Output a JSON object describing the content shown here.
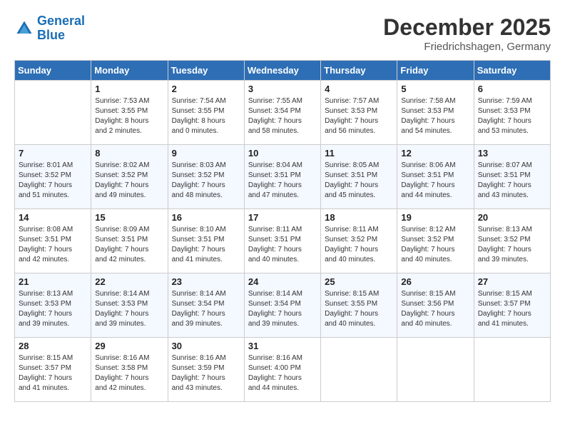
{
  "header": {
    "logo_line1": "General",
    "logo_line2": "Blue",
    "month": "December 2025",
    "location": "Friedrichshagen, Germany"
  },
  "weekdays": [
    "Sunday",
    "Monday",
    "Tuesday",
    "Wednesday",
    "Thursday",
    "Friday",
    "Saturday"
  ],
  "weeks": [
    [
      {
        "day": "",
        "info": ""
      },
      {
        "day": "1",
        "info": "Sunrise: 7:53 AM\nSunset: 3:55 PM\nDaylight: 8 hours\nand 2 minutes."
      },
      {
        "day": "2",
        "info": "Sunrise: 7:54 AM\nSunset: 3:55 PM\nDaylight: 8 hours\nand 0 minutes."
      },
      {
        "day": "3",
        "info": "Sunrise: 7:55 AM\nSunset: 3:54 PM\nDaylight: 7 hours\nand 58 minutes."
      },
      {
        "day": "4",
        "info": "Sunrise: 7:57 AM\nSunset: 3:53 PM\nDaylight: 7 hours\nand 56 minutes."
      },
      {
        "day": "5",
        "info": "Sunrise: 7:58 AM\nSunset: 3:53 PM\nDaylight: 7 hours\nand 54 minutes."
      },
      {
        "day": "6",
        "info": "Sunrise: 7:59 AM\nSunset: 3:53 PM\nDaylight: 7 hours\nand 53 minutes."
      }
    ],
    [
      {
        "day": "7",
        "info": "Sunrise: 8:01 AM\nSunset: 3:52 PM\nDaylight: 7 hours\nand 51 minutes."
      },
      {
        "day": "8",
        "info": "Sunrise: 8:02 AM\nSunset: 3:52 PM\nDaylight: 7 hours\nand 49 minutes."
      },
      {
        "day": "9",
        "info": "Sunrise: 8:03 AM\nSunset: 3:52 PM\nDaylight: 7 hours\nand 48 minutes."
      },
      {
        "day": "10",
        "info": "Sunrise: 8:04 AM\nSunset: 3:51 PM\nDaylight: 7 hours\nand 47 minutes."
      },
      {
        "day": "11",
        "info": "Sunrise: 8:05 AM\nSunset: 3:51 PM\nDaylight: 7 hours\nand 45 minutes."
      },
      {
        "day": "12",
        "info": "Sunrise: 8:06 AM\nSunset: 3:51 PM\nDaylight: 7 hours\nand 44 minutes."
      },
      {
        "day": "13",
        "info": "Sunrise: 8:07 AM\nSunset: 3:51 PM\nDaylight: 7 hours\nand 43 minutes."
      }
    ],
    [
      {
        "day": "14",
        "info": "Sunrise: 8:08 AM\nSunset: 3:51 PM\nDaylight: 7 hours\nand 42 minutes."
      },
      {
        "day": "15",
        "info": "Sunrise: 8:09 AM\nSunset: 3:51 PM\nDaylight: 7 hours\nand 42 minutes."
      },
      {
        "day": "16",
        "info": "Sunrise: 8:10 AM\nSunset: 3:51 PM\nDaylight: 7 hours\nand 41 minutes."
      },
      {
        "day": "17",
        "info": "Sunrise: 8:11 AM\nSunset: 3:51 PM\nDaylight: 7 hours\nand 40 minutes."
      },
      {
        "day": "18",
        "info": "Sunrise: 8:11 AM\nSunset: 3:52 PM\nDaylight: 7 hours\nand 40 minutes."
      },
      {
        "day": "19",
        "info": "Sunrise: 8:12 AM\nSunset: 3:52 PM\nDaylight: 7 hours\nand 40 minutes."
      },
      {
        "day": "20",
        "info": "Sunrise: 8:13 AM\nSunset: 3:52 PM\nDaylight: 7 hours\nand 39 minutes."
      }
    ],
    [
      {
        "day": "21",
        "info": "Sunrise: 8:13 AM\nSunset: 3:53 PM\nDaylight: 7 hours\nand 39 minutes."
      },
      {
        "day": "22",
        "info": "Sunrise: 8:14 AM\nSunset: 3:53 PM\nDaylight: 7 hours\nand 39 minutes."
      },
      {
        "day": "23",
        "info": "Sunrise: 8:14 AM\nSunset: 3:54 PM\nDaylight: 7 hours\nand 39 minutes."
      },
      {
        "day": "24",
        "info": "Sunrise: 8:14 AM\nSunset: 3:54 PM\nDaylight: 7 hours\nand 39 minutes."
      },
      {
        "day": "25",
        "info": "Sunrise: 8:15 AM\nSunset: 3:55 PM\nDaylight: 7 hours\nand 40 minutes."
      },
      {
        "day": "26",
        "info": "Sunrise: 8:15 AM\nSunset: 3:56 PM\nDaylight: 7 hours\nand 40 minutes."
      },
      {
        "day": "27",
        "info": "Sunrise: 8:15 AM\nSunset: 3:57 PM\nDaylight: 7 hours\nand 41 minutes."
      }
    ],
    [
      {
        "day": "28",
        "info": "Sunrise: 8:15 AM\nSunset: 3:57 PM\nDaylight: 7 hours\nand 41 minutes."
      },
      {
        "day": "29",
        "info": "Sunrise: 8:16 AM\nSunset: 3:58 PM\nDaylight: 7 hours\nand 42 minutes."
      },
      {
        "day": "30",
        "info": "Sunrise: 8:16 AM\nSunset: 3:59 PM\nDaylight: 7 hours\nand 43 minutes."
      },
      {
        "day": "31",
        "info": "Sunrise: 8:16 AM\nSunset: 4:00 PM\nDaylight: 7 hours\nand 44 minutes."
      },
      {
        "day": "",
        "info": ""
      },
      {
        "day": "",
        "info": ""
      },
      {
        "day": "",
        "info": ""
      }
    ]
  ]
}
